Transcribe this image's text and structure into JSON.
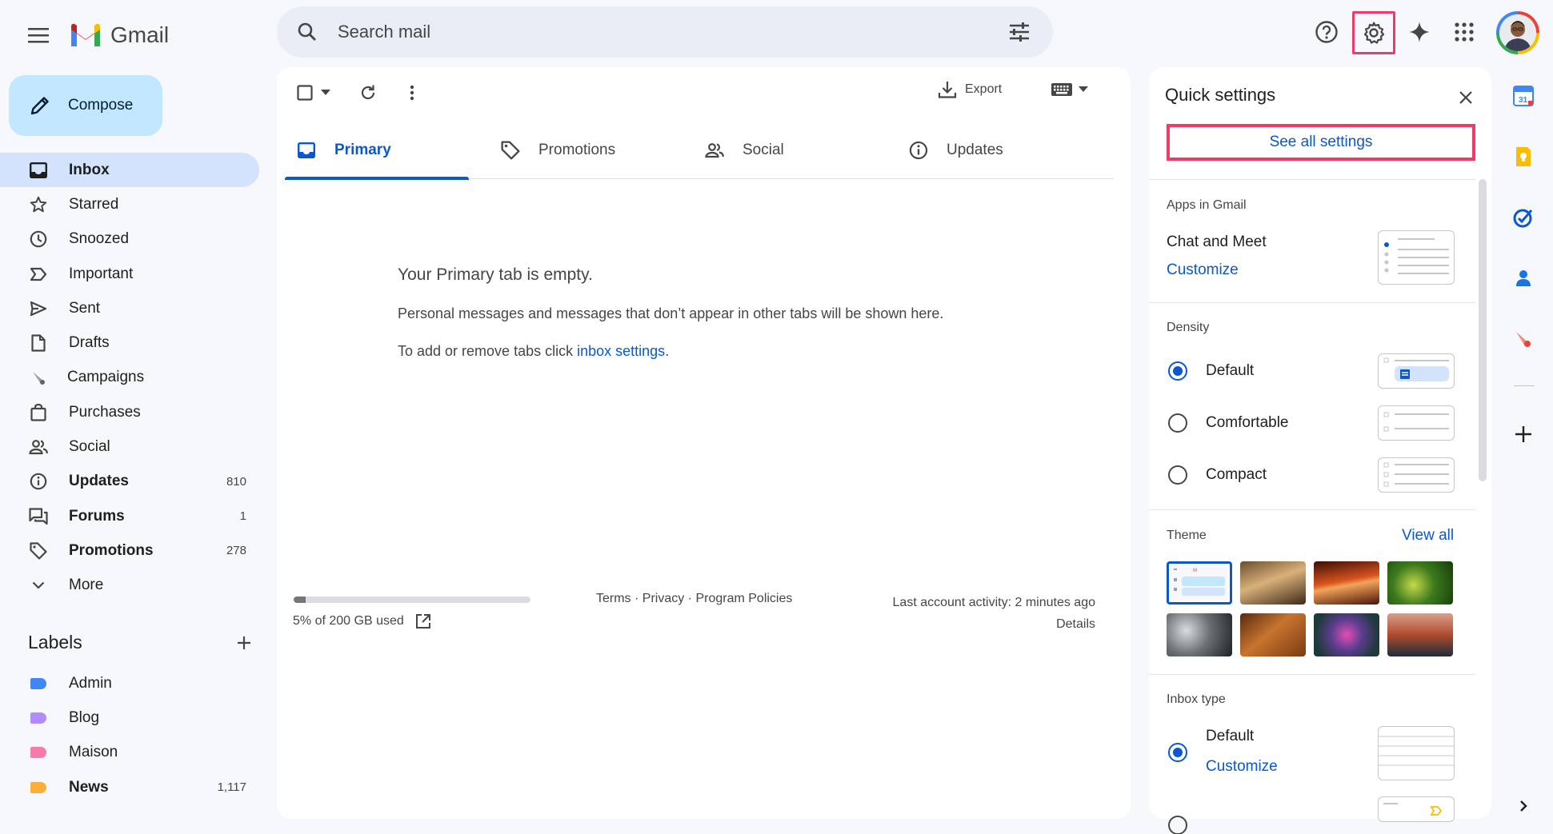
{
  "app": {
    "name": "Gmail"
  },
  "search": {
    "placeholder": "Search mail"
  },
  "compose": {
    "label": "Compose"
  },
  "nav": [
    {
      "label": "Inbox",
      "icon": "inbox-icon",
      "active": true,
      "bold": true,
      "count": ""
    },
    {
      "label": "Starred",
      "icon": "star-icon",
      "count": ""
    },
    {
      "label": "Snoozed",
      "icon": "clock-icon",
      "count": ""
    },
    {
      "label": "Important",
      "icon": "important-icon",
      "count": ""
    },
    {
      "label": "Sent",
      "icon": "send-icon",
      "count": ""
    },
    {
      "label": "Drafts",
      "icon": "draft-icon",
      "count": ""
    },
    {
      "label": "Campaigns",
      "icon": "campaigns-icon",
      "count": ""
    },
    {
      "label": "Purchases",
      "icon": "bag-icon",
      "count": ""
    },
    {
      "label": "Social",
      "icon": "people-icon",
      "count": ""
    },
    {
      "label": "Updates",
      "icon": "info-icon",
      "bold": true,
      "count": "810"
    },
    {
      "label": "Forums",
      "icon": "forum-icon",
      "bold": true,
      "count": "1"
    },
    {
      "label": "Promotions",
      "icon": "tag-icon",
      "bold": true,
      "count": "278"
    },
    {
      "label": "More",
      "icon": "chevron-down-icon",
      "count": ""
    }
  ],
  "labels": {
    "heading": "Labels",
    "items": [
      {
        "name": "Admin",
        "color": "#4285f4",
        "count": ""
      },
      {
        "name": "Blog",
        "color": "#b18cfe",
        "count": ""
      },
      {
        "name": "Maison",
        "color": "#f67ba8",
        "count": ""
      },
      {
        "name": "News",
        "color": "#fbae3c",
        "bold": true,
        "count": "1,117"
      }
    ]
  },
  "toolbar": {
    "export_label": "Export"
  },
  "tabs": [
    {
      "label": "Primary",
      "icon": "inbox-tab-icon",
      "active": true
    },
    {
      "label": "Promotions",
      "icon": "tag-icon"
    },
    {
      "label": "Social",
      "icon": "people-icon"
    },
    {
      "label": "Updates",
      "icon": "info-icon"
    }
  ],
  "empty": {
    "title": "Your Primary tab is empty.",
    "line1": "Personal messages and messages that don’t appear in other tabs will be shown here.",
    "line2_prefix": "To add or remove tabs click ",
    "line2_link": "inbox settings",
    "line2_suffix": "."
  },
  "footer": {
    "storage_text": "5% of 200 GB used",
    "storage_fraction": 0.05,
    "links": "Terms · Privacy · Program Policies",
    "activity": "Last account activity: 2 minutes ago",
    "details": "Details"
  },
  "quick_settings": {
    "title": "Quick settings",
    "see_all": "See all settings",
    "apps_heading": "Apps in Gmail",
    "chat_meet": "Chat and Meet",
    "customize": "Customize",
    "density_heading": "Density",
    "density_options": [
      "Default",
      "Comfortable",
      "Compact"
    ],
    "theme_heading": "Theme",
    "view_all": "View all",
    "inbox_type_heading": "Inbox type",
    "inbox_default": "Default",
    "inbox_customize": "Customize"
  },
  "colors": {
    "accent": "#0b57d0",
    "highlight": "#ee3c69",
    "compose_bg": "#c2e7ff",
    "active_nav": "#d3e3fd"
  }
}
